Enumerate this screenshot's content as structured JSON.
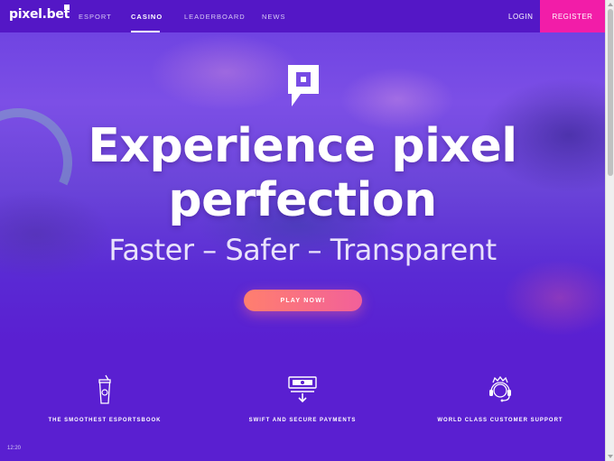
{
  "nav": {
    "logo": "pixel.bet",
    "links": [
      "ESPORT",
      "CASINO",
      "LEADERBOARD",
      "NEWS"
    ],
    "active": "CASINO",
    "login": "LOGIN",
    "register": "REGISTER"
  },
  "hero": {
    "icon": "pixel-logo-icon",
    "headline_line1": "Experience pixel",
    "headline_line2": "perfection",
    "subline": "Faster – Safer – Transparent",
    "cta": "PLAY NOW!"
  },
  "features": [
    {
      "icon": "cup-icon",
      "label": "THE SMOOTHEST ESPORTSBOOK"
    },
    {
      "icon": "payment-icon",
      "label": "SWIFT AND SECURE PAYMENTS"
    },
    {
      "icon": "support-headset-icon",
      "label": "WORLD CLASS CUSTOMER SUPPORT"
    }
  ],
  "status": {
    "time": "12:20"
  },
  "colors": {
    "nav_bg": "#5417c6",
    "page_bg": "#5a1fd1",
    "register_bg": "#f21da8",
    "cta_start": "#ff7f6e",
    "cta_end": "#f2609a"
  }
}
